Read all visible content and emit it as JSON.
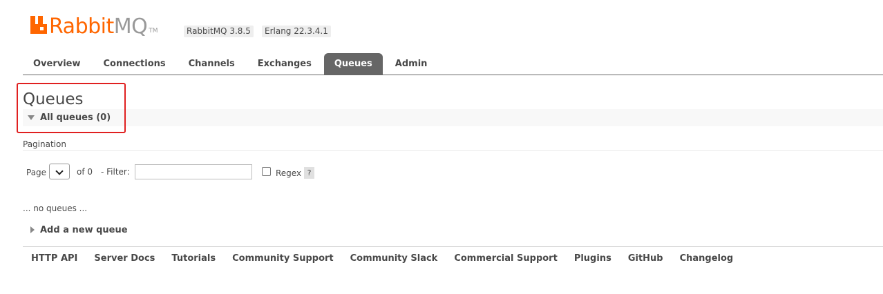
{
  "header": {
    "logo_rabbit": "Rabbit",
    "logo_mq": "MQ",
    "logo_tm": "TM",
    "rabbitmq_version": "RabbitMQ 3.8.5",
    "erlang_version": "Erlang 22.3.4.1"
  },
  "tabs": [
    {
      "label": "Overview",
      "active": false
    },
    {
      "label": "Connections",
      "active": false
    },
    {
      "label": "Channels",
      "active": false
    },
    {
      "label": "Exchanges",
      "active": false
    },
    {
      "label": "Queues",
      "active": true
    },
    {
      "label": "Admin",
      "active": false
    }
  ],
  "main": {
    "title": "Queues",
    "section_label": "All queues (0)",
    "pagination_label": "Pagination",
    "page_label": "Page",
    "of_label": "of 0",
    "filter_label": "- Filter:",
    "filter_value": "",
    "regex_label": "Regex",
    "regex_checked": false,
    "help_label": "?",
    "no_queues": "... no queues ...",
    "add_queue_label": "Add a new queue"
  },
  "footer": {
    "links": [
      "HTTP API",
      "Server Docs",
      "Tutorials",
      "Community Support",
      "Community Slack",
      "Commercial Support",
      "Plugins",
      "GitHub",
      "Changelog"
    ]
  },
  "colors": {
    "brand_orange": "#ff6600",
    "active_tab_bg": "#666666",
    "highlight_box": "#e02020"
  },
  "icons": {
    "section_toggle": "triangle-down-icon",
    "add_toggle": "triangle-right-icon",
    "select_chevron": "chevron-down-icon"
  }
}
